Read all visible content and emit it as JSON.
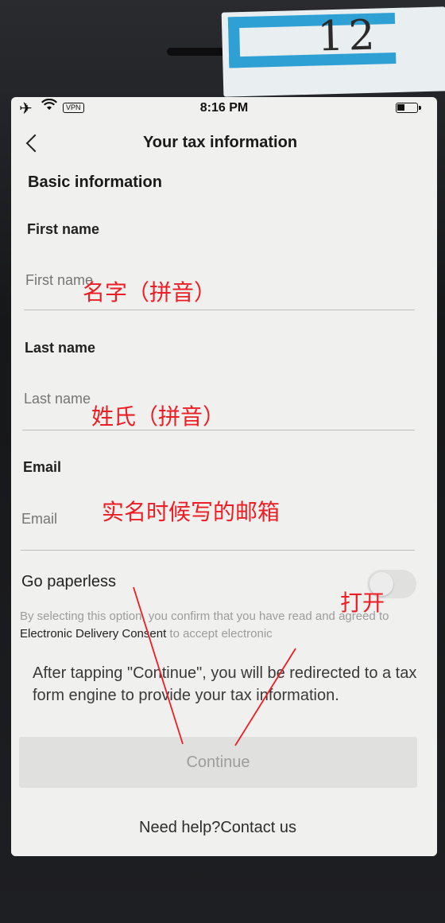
{
  "sticker": {
    "number": "12"
  },
  "status_bar": {
    "vpn": "VPN",
    "time": "8:16 PM"
  },
  "nav": {
    "title": "Your tax information"
  },
  "form": {
    "section_title": "Basic information",
    "first_name": {
      "label": "First name",
      "placeholder": "First name"
    },
    "last_name": {
      "label": "Last name",
      "placeholder": "Last name"
    },
    "email": {
      "label": "Email",
      "placeholder": "Email"
    },
    "paperless": {
      "label": "Go paperless",
      "enabled": false,
      "consent_before": "By selecting this option, you confirm that you have read and agreed to ",
      "consent_link": "Electronic Delivery Consent",
      "consent_after": " to accept electronic"
    }
  },
  "bottom": {
    "redirect_text": "After tapping \"Continue\", you will be redirected to a tax form engine to provide your tax information.",
    "continue_label": "Continue",
    "help_text": "Need help?",
    "contact_link": "Contact us"
  },
  "annotations": {
    "first_name_note": "名字（拼音）",
    "last_name_note": "姓氏（拼音）",
    "email_note": "实名时候写的邮箱",
    "toggle_note": "打开",
    "color": "#ee1d23"
  }
}
